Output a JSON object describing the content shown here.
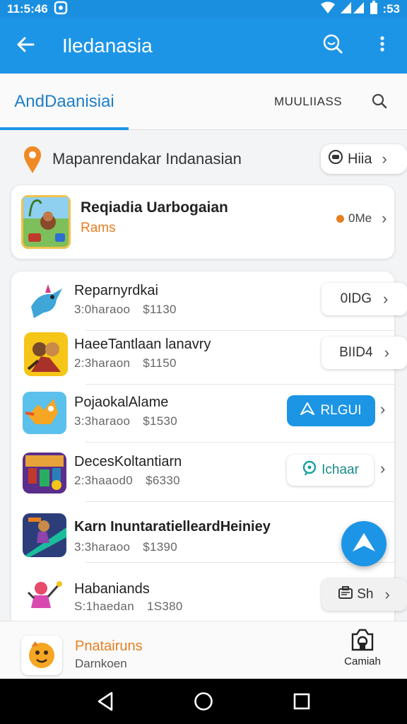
{
  "status_bar": {
    "time": "11:5:46",
    "battery_time": ":53"
  },
  "app_bar": {
    "title": "Iledanasia",
    "back_icon": "arrow-left-icon",
    "search_icon": "search-icon",
    "menu_icon": "more-vert-icon"
  },
  "tabs": {
    "active": "AndDaanisiai",
    "other": "MUULIIASS"
  },
  "location": {
    "text": "Mapanrendakar Indanasian",
    "chip_label": "Hiia"
  },
  "featured": {
    "title": "Reqiadia Uarbogaian",
    "subtitle": "Rams",
    "meta": "0Me"
  },
  "items": [
    {
      "name": "Reparnyrdkai",
      "duration": "3:0haraoo",
      "price": "$1130",
      "action": "0IDG"
    },
    {
      "name": "HaeeTantlaan lanavry",
      "duration": "2:3haraon",
      "price": "$1150",
      "action": "BIID4"
    },
    {
      "name": "PojaokalAlame",
      "duration": "3:3haraoo",
      "price": "$1530",
      "action": "RLGUI"
    },
    {
      "name": "DecesKoltantiarn",
      "duration": "2:3haaod0",
      "price": "$6330",
      "action": "Ichaar"
    },
    {
      "name": "Karn InuntaratielleardHeiniey",
      "duration": "3:3haraoo",
      "price": "$1390",
      "action": ""
    },
    {
      "name": "Habaniands",
      "duration": "S:1haedan",
      "price": "1S380",
      "action": "Sh"
    }
  ],
  "bottom_bar": {
    "title": "Pnatairuns",
    "subtitle": "Darnkoen",
    "camera_label": "Camiah"
  },
  "colors": {
    "primary": "#1d95e6",
    "accent": "#e67e22",
    "background": "#f3f4f6"
  }
}
